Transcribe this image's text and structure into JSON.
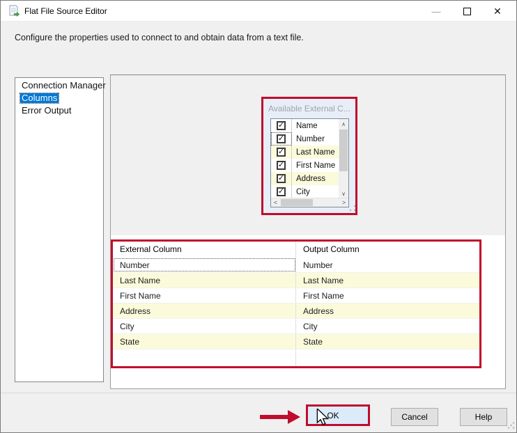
{
  "window": {
    "title": "Flat File Source Editor",
    "controls": {
      "minimize": "—",
      "close": "✕"
    }
  },
  "header": {
    "description": "Configure the properties used to connect to and obtain data from a text file."
  },
  "nav": {
    "items": [
      {
        "label": "Connection Manager",
        "selected": false
      },
      {
        "label": "Columns",
        "selected": true
      },
      {
        "label": "Error Output",
        "selected": false
      }
    ]
  },
  "available_columns": {
    "title": "Available External C...",
    "rows": [
      {
        "label": "Name",
        "checked": true,
        "highlight": false,
        "focused": false
      },
      {
        "label": "Number",
        "checked": true,
        "highlight": false,
        "focused": true
      },
      {
        "label": "Last Name",
        "checked": true,
        "highlight": true,
        "focused": false
      },
      {
        "label": "First Name",
        "checked": true,
        "highlight": false,
        "focused": false
      },
      {
        "label": "Address",
        "checked": true,
        "highlight": true,
        "focused": false
      },
      {
        "label": "City",
        "checked": true,
        "highlight": false,
        "focused": false
      }
    ]
  },
  "mapping_table": {
    "headers": {
      "external": "External Column",
      "output": "Output Column"
    },
    "rows": [
      {
        "external": "Number",
        "output": "Number",
        "highlight": false,
        "focused": true
      },
      {
        "external": "Last Name",
        "output": "Last Name",
        "highlight": true,
        "focused": false
      },
      {
        "external": "First Name",
        "output": "First Name",
        "highlight": false,
        "focused": false
      },
      {
        "external": "Address",
        "output": "Address",
        "highlight": true,
        "focused": false
      },
      {
        "external": "City",
        "output": "City",
        "highlight": false,
        "focused": false
      },
      {
        "external": "State",
        "output": "State",
        "highlight": true,
        "focused": false
      },
      {
        "external": "",
        "output": "",
        "highlight": false,
        "focused": false
      }
    ]
  },
  "actions": {
    "ok": "OK",
    "cancel": "Cancel",
    "help": "Help"
  },
  "icons": {
    "checkmark": "✓",
    "up": "∧",
    "down": "∨",
    "left": "<",
    "right": ">"
  },
  "colors": {
    "annotation_red": "#c00c2d",
    "selection_blue": "#0078d7",
    "row_yellow": "#fbfbdc",
    "ok_hover_fill": "#dcebf9",
    "button_face": "#e1e1e1"
  }
}
